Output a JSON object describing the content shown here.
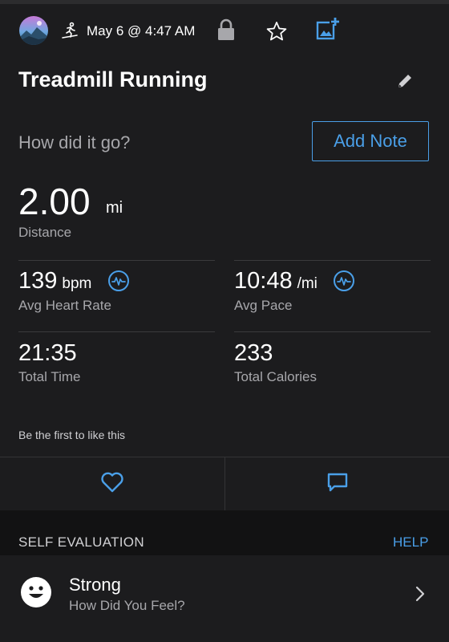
{
  "header": {
    "date": "May 6 @ 4:47 AM",
    "activity_icon": "treadmill-runner-icon",
    "icons": [
      "lock-icon",
      "star-icon",
      "add-photo-icon"
    ]
  },
  "activity": {
    "title": "Treadmill Running",
    "question": "How did it go?",
    "add_note_label": "Add Note"
  },
  "distance": {
    "value": "2.00",
    "unit": "mi",
    "label": "Distance"
  },
  "stats": [
    {
      "value": "139",
      "unit": "bpm",
      "label": "Avg Heart Rate",
      "icon": "heart-rate-chart-icon"
    },
    {
      "value": "10:48",
      "unit": "/mi",
      "label": "Avg Pace",
      "icon": "pace-chart-icon"
    },
    {
      "value": "21:35",
      "label": "Total Time"
    },
    {
      "value": "233",
      "label": "Total Calories"
    }
  ],
  "social": {
    "likes_text": "Be the first to like this",
    "like_icon": "heart-icon",
    "comment_icon": "comment-icon"
  },
  "self_evaluation": {
    "section_title": "SELF EVALUATION",
    "help_label": "HELP",
    "feeling": "Strong",
    "prompt": "How Did You Feel?"
  },
  "colors": {
    "background": "#1c1c1e",
    "accent": "#4a9fe8",
    "secondary_text": "#a7a7ab",
    "section_band": "#121213"
  }
}
